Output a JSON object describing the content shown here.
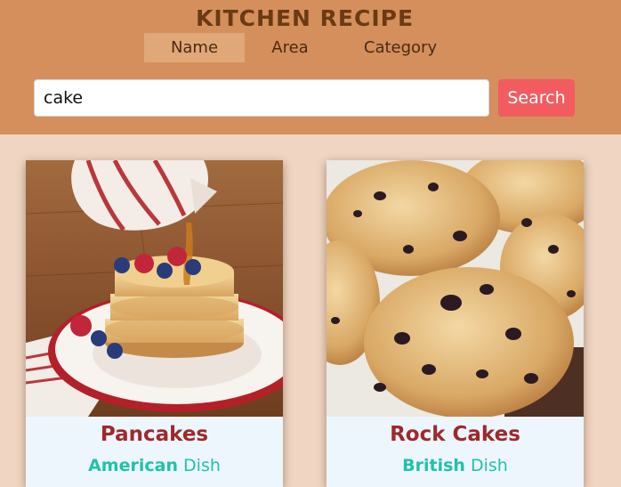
{
  "app": {
    "title": "KITCHEN RECIPE"
  },
  "tabs": [
    {
      "label": "Name",
      "active": true
    },
    {
      "label": "Area",
      "active": false
    },
    {
      "label": "Category",
      "active": false
    }
  ],
  "search": {
    "value": "cake",
    "button_label": "Search"
  },
  "recipes": [
    {
      "name": "Pancakes",
      "area": "American",
      "suffix": "Dish"
    },
    {
      "name": "Rock Cakes",
      "area": "British",
      "suffix": "Dish"
    }
  ],
  "colors": {
    "header_bg": "#d48f5d",
    "page_bg": "#f0d6c2",
    "title": "#6b3a12",
    "active_tab": "#e0a878",
    "search_button": "#f25c61",
    "recipe_name": "#9c2a2c",
    "recipe_area": "#1fc2a9"
  }
}
